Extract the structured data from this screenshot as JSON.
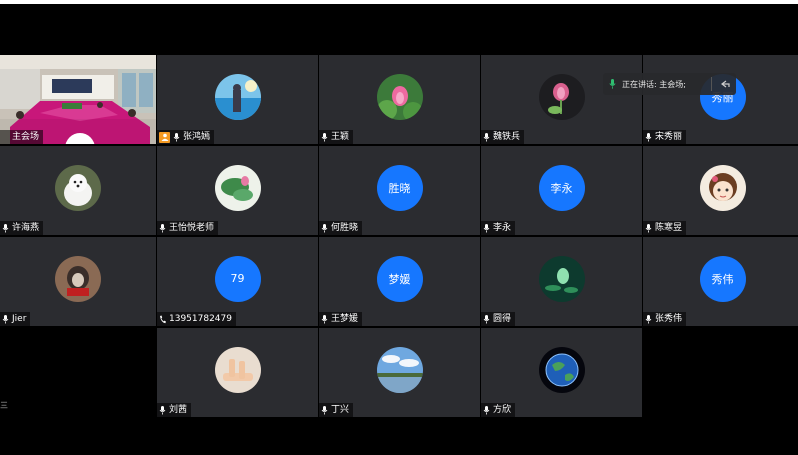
{
  "speaking_bar": {
    "label": "正在讲话: 主会场;"
  },
  "tiles": [
    {
      "name": "主会场",
      "avatar_text": "",
      "badge": false,
      "icon": "mic-icon"
    },
    {
      "name": "张鸿嫣",
      "avatar_text": "",
      "badge": true,
      "icon": "mic-icon"
    },
    {
      "name": "王颖",
      "avatar_text": "",
      "badge": false,
      "icon": "mic-icon"
    },
    {
      "name": "魏铁兵",
      "avatar_text": "",
      "badge": false,
      "icon": "mic-icon"
    },
    {
      "name": "宋秀丽",
      "avatar_text": "秀丽",
      "badge": false,
      "icon": "mic-icon"
    },
    {
      "name": "许海燕",
      "avatar_text": "",
      "badge": false,
      "icon": "mic-icon"
    },
    {
      "name": "王怡悦老师",
      "avatar_text": "",
      "badge": false,
      "icon": "mic-icon"
    },
    {
      "name": "何胜晓",
      "avatar_text": "胜晓",
      "badge": false,
      "icon": "mic-icon"
    },
    {
      "name": "李永",
      "avatar_text": "李永",
      "badge": false,
      "icon": "mic-icon"
    },
    {
      "name": "陈寒昱",
      "avatar_text": "",
      "badge": false,
      "icon": "mic-icon"
    },
    {
      "name": "Jier",
      "avatar_text": "",
      "badge": false,
      "icon": "mic-icon"
    },
    {
      "name": "13951782479",
      "avatar_text": "79",
      "badge": false,
      "icon": "phone-icon"
    },
    {
      "name": "王梦媛",
      "avatar_text": "梦媛",
      "badge": false,
      "icon": "mic-icon"
    },
    {
      "name": "圆得",
      "avatar_text": "",
      "badge": false,
      "icon": "mic-icon"
    },
    {
      "name": "张秀伟",
      "avatar_text": "秀伟",
      "badge": false,
      "icon": "mic-icon"
    },
    {
      "name": "刘茜",
      "avatar_text": "",
      "badge": false,
      "icon": "mic-icon"
    },
    {
      "name": "丁兴",
      "avatar_text": "",
      "badge": false,
      "icon": "mic-icon"
    },
    {
      "name": "方欣",
      "avatar_text": "",
      "badge": false,
      "icon": "mic-icon"
    }
  ],
  "side_label": "三",
  "colors": {
    "tile_bg": "#2b2c30",
    "avatar_blue": "#1677ff",
    "host_orange": "#f59a23"
  }
}
